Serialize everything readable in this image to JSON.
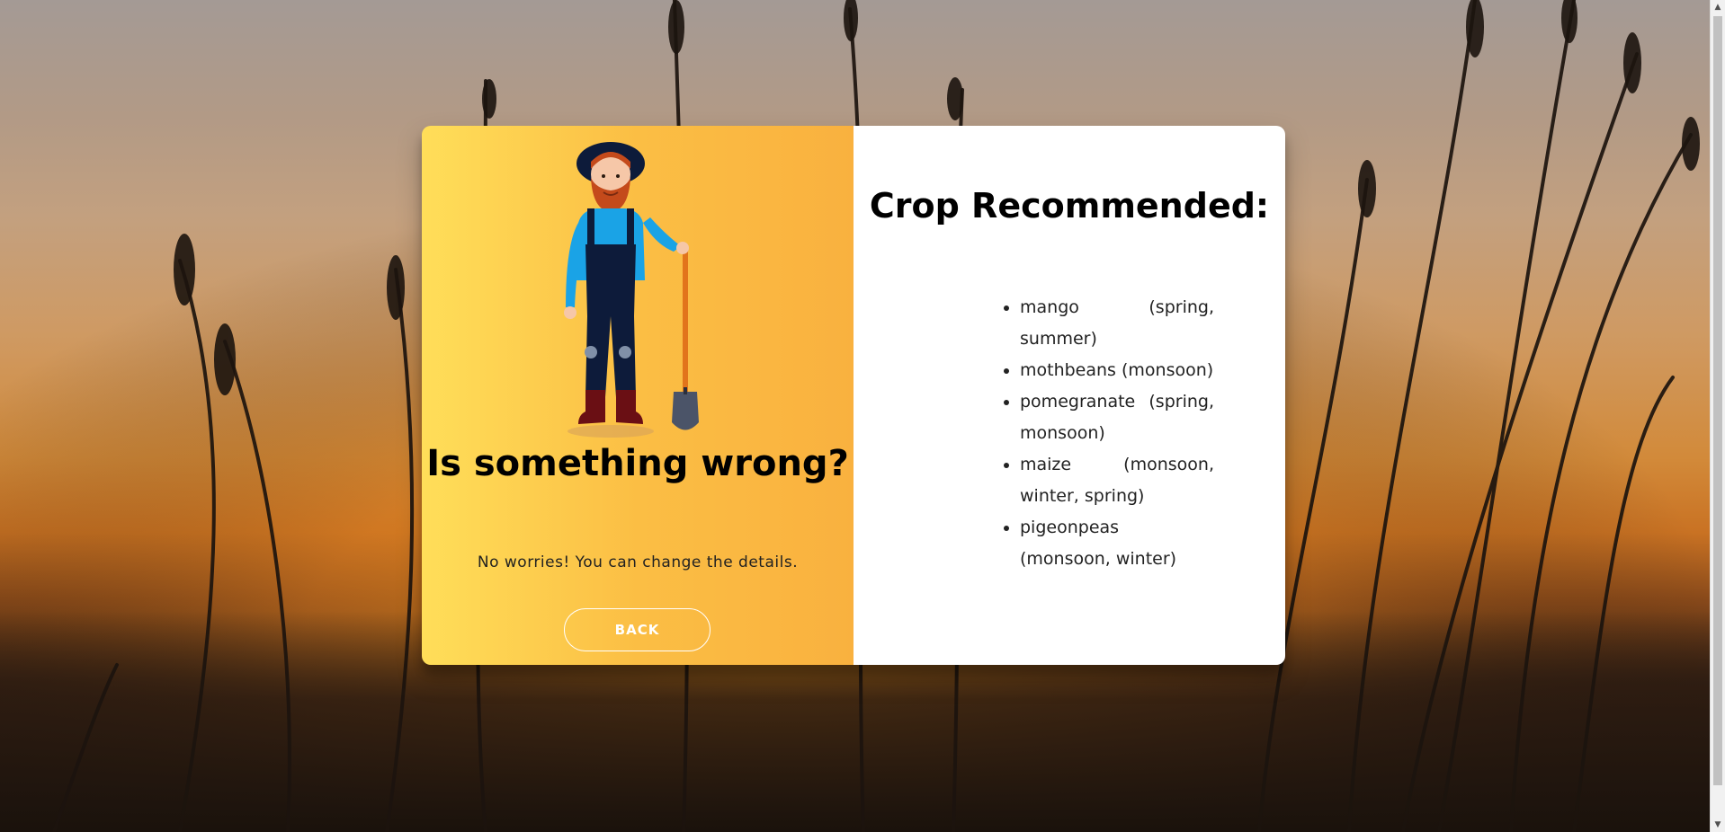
{
  "left_panel": {
    "title": "Is something wrong?",
    "message": "No worries! You can change the details.",
    "back_label": "BACK",
    "illustration": "farmer-with-shovel"
  },
  "right_panel": {
    "title": "Crop Recommended:",
    "crops": [
      "mango (spring, summer)",
      "mothbeans (monsoon)",
      "pomegranate (spring, monsoon)",
      "maize (monsoon, winter, spring)",
      "pigeonpeas (monsoon, winter)"
    ]
  },
  "colors": {
    "gradient_start": "#ffde59",
    "gradient_end": "#f9b13f",
    "button_border": "#ffffff",
    "card_right": "#ffffff"
  },
  "icons": {
    "scroll_up": "scroll-up-arrow-icon",
    "scroll_down": "scroll-down-arrow-icon"
  }
}
